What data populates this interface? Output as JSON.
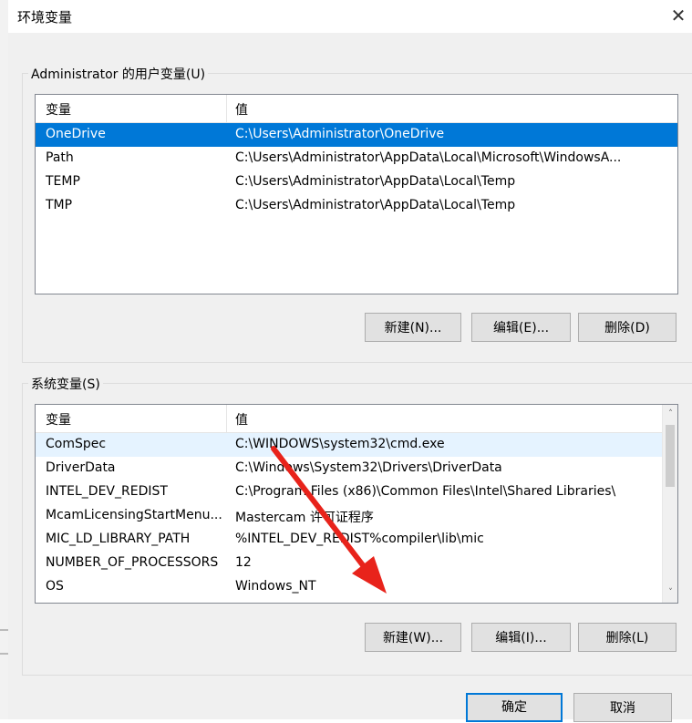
{
  "window": {
    "title": "环境变量",
    "close_glyph": "✕"
  },
  "user_section": {
    "label": "Administrator 的用户变量(U)",
    "col_name": "变量",
    "col_value": "值",
    "rows": [
      {
        "name": "OneDrive",
        "value": "C:\\Users\\Administrator\\OneDrive"
      },
      {
        "name": "Path",
        "value": "C:\\Users\\Administrator\\AppData\\Local\\Microsoft\\WindowsA..."
      },
      {
        "name": "TEMP",
        "value": "C:\\Users\\Administrator\\AppData\\Local\\Temp"
      },
      {
        "name": "TMP",
        "value": "C:\\Users\\Administrator\\AppData\\Local\\Temp"
      }
    ],
    "selected_index": 0,
    "buttons": {
      "new": "新建(N)...",
      "edit": "编辑(E)...",
      "delete": "删除(D)"
    }
  },
  "system_section": {
    "label": "系统变量(S)",
    "col_name": "变量",
    "col_value": "值",
    "rows": [
      {
        "name": "ComSpec",
        "value": "C:\\WINDOWS\\system32\\cmd.exe"
      },
      {
        "name": "DriverData",
        "value": "C:\\Windows\\System32\\Drivers\\DriverData"
      },
      {
        "name": "INTEL_DEV_REDIST",
        "value": "C:\\Program Files (x86)\\Common Files\\Intel\\Shared Libraries\\"
      },
      {
        "name": "McamLicensingStartMenu...",
        "value": "Mastercam 许可证程序"
      },
      {
        "name": "MIC_LD_LIBRARY_PATH",
        "value": "%INTEL_DEV_REDIST%compiler\\lib\\mic"
      },
      {
        "name": "NUMBER_OF_PROCESSORS",
        "value": "12"
      },
      {
        "name": "OS",
        "value": "Windows_NT"
      }
    ],
    "hover_index": 0,
    "buttons": {
      "new": "新建(W)...",
      "edit": "编辑(I)...",
      "delete": "删除(L)"
    },
    "scroll_up": "˄",
    "scroll_down": "˅"
  },
  "footer": {
    "ok": "确定",
    "cancel": "取消"
  },
  "colors": {
    "selection": "#0078d7",
    "annotation_arrow": "#e8231b"
  }
}
